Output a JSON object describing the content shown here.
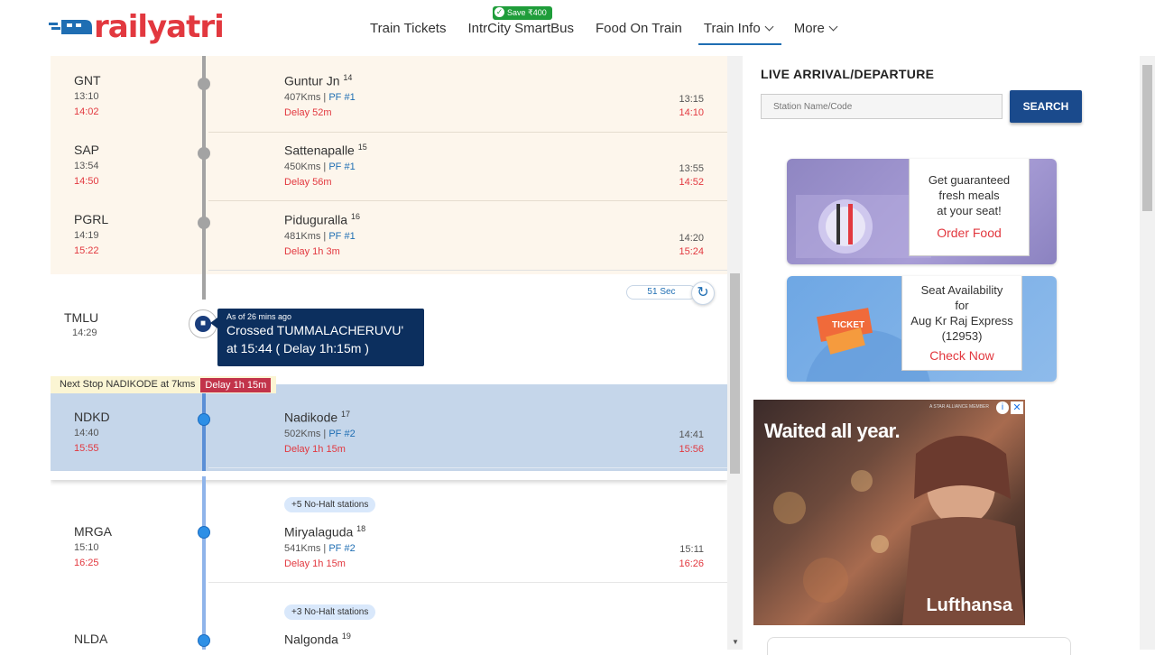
{
  "header": {
    "logo": "railyatri",
    "save_badge": "Save ₹400",
    "nav": [
      {
        "label": "Train Tickets"
      },
      {
        "label": "IntrCity SmartBus"
      },
      {
        "label": "Food On Train"
      },
      {
        "label": "Train Info"
      },
      {
        "label": "More"
      }
    ]
  },
  "stations": [
    {
      "code": "GNT",
      "sched_arr": "13:10",
      "act_arr": "14:02",
      "name": "Guntur Jn",
      "num": "14",
      "kms": "407Kms",
      "pf": "PF #1",
      "delay": "Delay 52m",
      "sched_dep": "13:15",
      "act_dep": "14:10"
    },
    {
      "code": "SAP",
      "sched_arr": "13:54",
      "act_arr": "14:50",
      "name": "Sattenapalle",
      "num": "15",
      "kms": "450Kms",
      "pf": "PF #1",
      "delay": "Delay 56m",
      "sched_dep": "13:55",
      "act_dep": "14:52"
    },
    {
      "code": "PGRL",
      "sched_arr": "14:19",
      "act_arr": "15:22",
      "name": "Piduguralla",
      "num": "16",
      "kms": "481Kms",
      "pf": "PF #1",
      "delay": "Delay 1h 3m",
      "sched_dep": "14:20",
      "act_dep": "15:24"
    },
    {
      "code": "NDKD",
      "sched_arr": "14:40",
      "act_arr": "15:55",
      "name": "Nadikode",
      "num": "17",
      "kms": "502Kms",
      "pf": "PF #2",
      "delay": "Delay 1h 15m",
      "sched_dep": "14:41",
      "act_dep": "15:56"
    },
    {
      "code": "MRGA",
      "sched_arr": "15:10",
      "act_arr": "16:25",
      "name": "Miryalaguda",
      "num": "18",
      "kms": "541Kms",
      "pf": "PF #2",
      "delay": "Delay 1h 15m",
      "sched_dep": "15:11",
      "act_dep": "16:26"
    },
    {
      "code": "NLDA",
      "name": "Nalgonda",
      "num": "19"
    }
  ],
  "current": {
    "code": "TMLU",
    "time": "14:29",
    "refresh": "51 Sec",
    "as_of": "As of 26 mins ago",
    "message": "Crossed TUMMALACHERUVU' at 15:44 ( Delay 1h:15m )",
    "next_stop": "Next Stop NADIKODE at 7kms",
    "next_delay": "Delay 1h 15m"
  },
  "halts": [
    "+5 No-Halt stations",
    "+3 No-Halt stations"
  ],
  "sidebar": {
    "live_title": "LIVE ARRIVAL/DEPARTURE",
    "live_placeholder": "Station Name/Code",
    "search_label": "SEARCH",
    "food_promo": {
      "text1": "Get guaranteed",
      "text2": "fresh meals",
      "text3": "at your seat!",
      "cta": "Order Food"
    },
    "seat_promo": {
      "text1": "Seat Availability",
      "text2": "for",
      "text3": "Aug Kr Raj Express",
      "text4": "(12953)",
      "cta": "Check Now",
      "ticket": "TICKET"
    },
    "ad": {
      "headline": "Waited all year.",
      "brand": "Lufthansa",
      "small": "A STAR ALLIANCE MEMBER"
    }
  },
  "colors": {
    "brand_red": "#e2383f",
    "brand_blue": "#1a4a8c",
    "delay_red": "#e2383f",
    "past_bg": "#fdf6ec",
    "current_bg": "#c5d6ea"
  }
}
